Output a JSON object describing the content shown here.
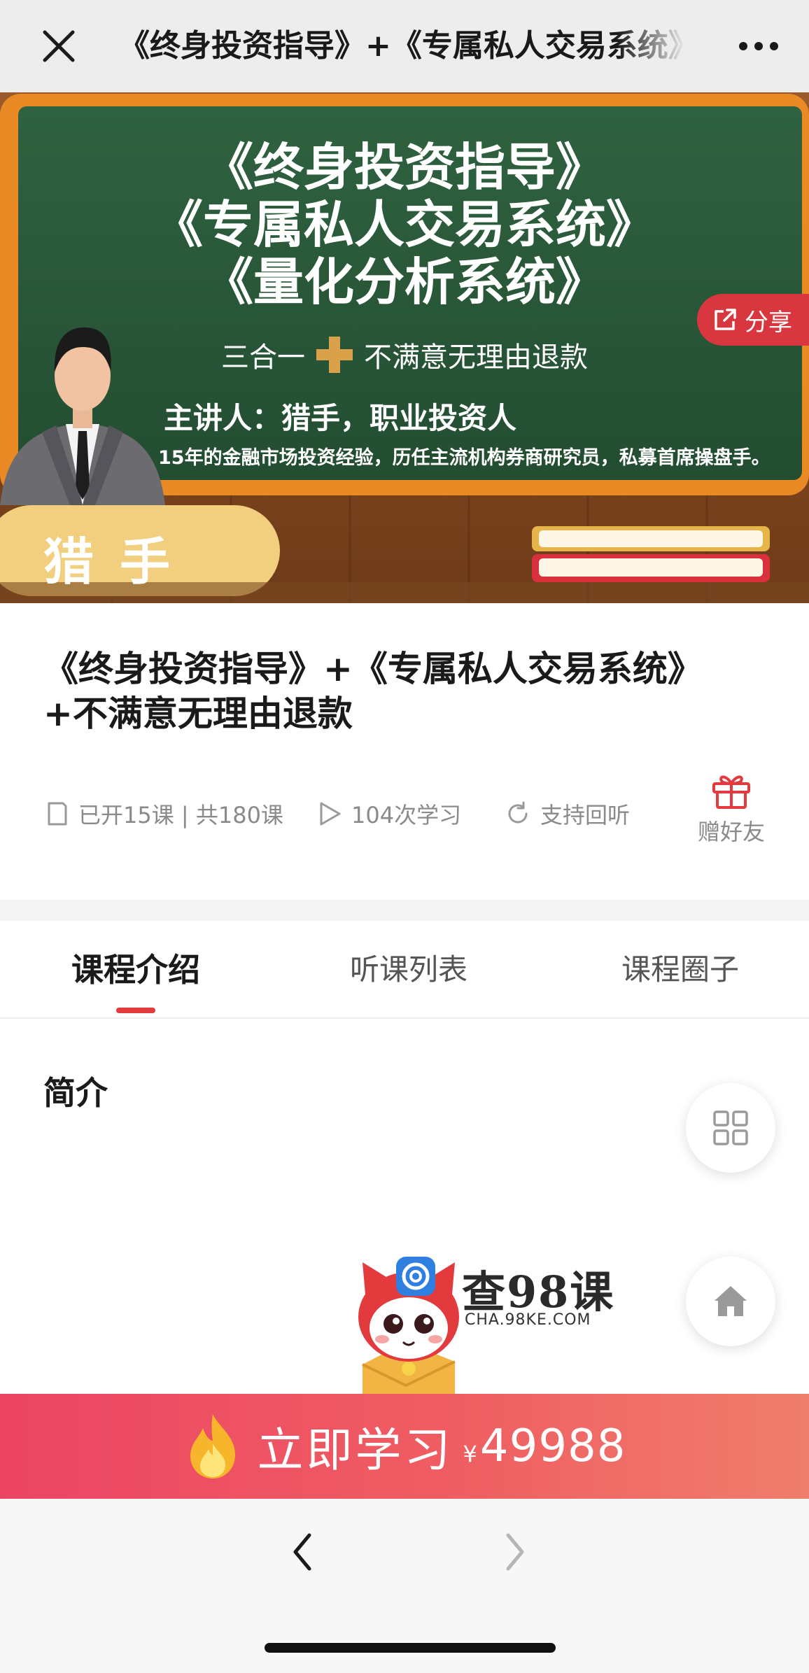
{
  "header": {
    "title": "《终身投资指导》+《专属私人交易系统》+不满意无理由退款"
  },
  "banner": {
    "line1": "《终身投资指导》",
    "line2": "《专属私人交易系统》",
    "line3": "《量化分析系统》",
    "three_in_one": "三合一",
    "refund": "不满意无理由退款",
    "speaker": "主讲人：猎手，职业投资人",
    "bio": "15年的金融市场投资经验，历任主流机构券商研究员，私募首席操盘手。",
    "name_badge": "猎 手",
    "share_label": "分享"
  },
  "course": {
    "title": "《终身投资指导》+《专属私人交易系统》+不满意无理由退款",
    "lessons": "已开15课 | 共180课",
    "study_count": "104次学习",
    "replay": "支持回听",
    "gift_label": "赠好友"
  },
  "tabs": [
    {
      "label": "课程介绍",
      "active": true
    },
    {
      "label": "听课列表",
      "active": false
    },
    {
      "label": "课程圈子",
      "active": false
    }
  ],
  "intro": {
    "heading": "简介"
  },
  "watermark": {
    "brand": "查98课",
    "url": "CHA.98KE.COM"
  },
  "cta": {
    "label": "立即学习",
    "currency": "¥",
    "price": "49988"
  },
  "colors": {
    "accent": "#e33a3d",
    "chalkboard": "#27573a",
    "board_frame": "#e98a24",
    "cta_start": "#ec4564",
    "cta_end": "#f07e6c"
  }
}
